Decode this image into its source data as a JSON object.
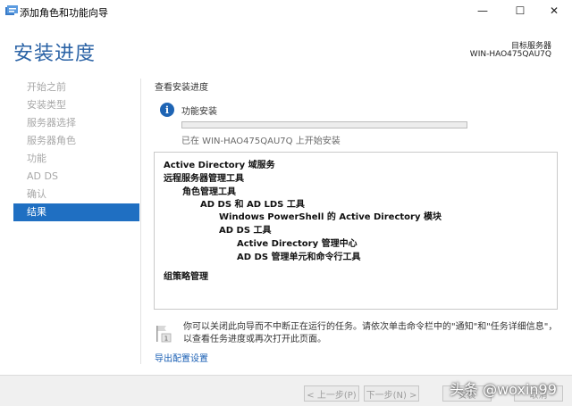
{
  "window": {
    "title": "添加角色和功能向导",
    "minimize": "—",
    "maximize": "☐",
    "close": "✕"
  },
  "header": {
    "page_title": "安装进度",
    "target_label": "目标服务器",
    "target_name": "WIN-HAO475QAU7Q"
  },
  "nav": {
    "items": [
      {
        "label": "开始之前",
        "active": false
      },
      {
        "label": "安装类型",
        "active": false
      },
      {
        "label": "服务器选择",
        "active": false
      },
      {
        "label": "服务器角色",
        "active": false
      },
      {
        "label": "功能",
        "active": false
      },
      {
        "label": "AD DS",
        "active": false
      },
      {
        "label": "确认",
        "active": false
      },
      {
        "label": "结果",
        "active": true
      }
    ]
  },
  "content": {
    "section_label": "查看安装进度",
    "feature_install": "功能安装",
    "progress_fraction": 0.0,
    "status_text": "已在 WIN-HAO475QAU7Q 上开始安装",
    "results": [
      {
        "text": "Active Directory 域服务",
        "indent": 0
      },
      {
        "text": "远程服务器管理工具",
        "indent": 0
      },
      {
        "text": "角色管理工具",
        "indent": 1
      },
      {
        "text": "AD DS 和 AD LDS 工具",
        "indent": 2
      },
      {
        "text": "Windows PowerShell 的 Active Directory 模块",
        "indent": 3
      },
      {
        "text": "AD DS 工具",
        "indent": 2
      },
      {
        "text": "Active Directory 管理中心",
        "indent": 3
      },
      {
        "text": "AD DS 管理单元和命令行工具",
        "indent": 3
      },
      {
        "text": "组策略管理",
        "indent": 0
      }
    ],
    "notice": "你可以关闭此向导而不中断正在运行的任务。请依次单击命令栏中的\"通知\"和\"任务详细信息\"，以查看任务进度或再次打开此页面。",
    "export_link": "导出配置设置"
  },
  "footer": {
    "prev": "< 上一步(P)",
    "next": "下一步(N) >",
    "install": "安装",
    "cancel": "取消"
  },
  "watermark": "头条 @woxin99",
  "colors": {
    "accent": "#1f6fc2",
    "title": "#2b63a6",
    "link": "#1a5fb4"
  }
}
